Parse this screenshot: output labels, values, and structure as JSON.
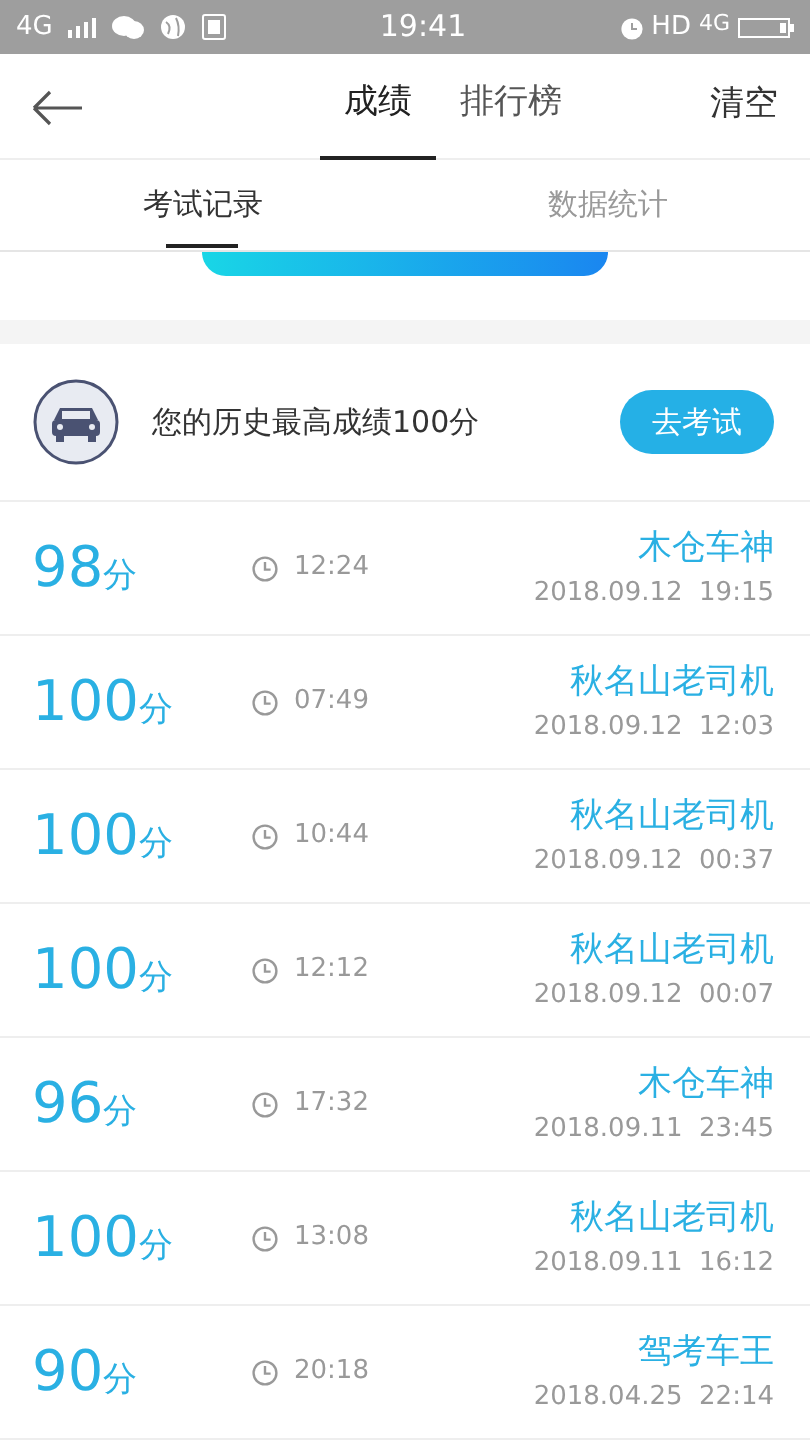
{
  "status_bar": {
    "network_left": "4G",
    "time": "19:41",
    "hd": "HD",
    "network_right": "4G"
  },
  "top_nav": {
    "tabs": [
      {
        "label": "成绩",
        "selected": true
      },
      {
        "label": "排行榜",
        "selected": false
      }
    ],
    "action": "清空"
  },
  "sub_tabs": [
    {
      "label": "考试记录",
      "selected": true
    },
    {
      "label": "数据统计",
      "selected": false
    }
  ],
  "best": {
    "text": "您的历史最高成绩100分",
    "button": "去考试"
  },
  "records": [
    {
      "score": "98",
      "unit": "分",
      "duration": "12:24",
      "title": "木仓车神",
      "date": "2018.09.12  19:15"
    },
    {
      "score": "100",
      "unit": "分",
      "duration": "07:49",
      "title": "秋名山老司机",
      "date": "2018.09.12  12:03"
    },
    {
      "score": "100",
      "unit": "分",
      "duration": "10:44",
      "title": "秋名山老司机",
      "date": "2018.09.12  00:37"
    },
    {
      "score": "100",
      "unit": "分",
      "duration": "12:12",
      "title": "秋名山老司机",
      "date": "2018.09.12  00:07"
    },
    {
      "score": "96",
      "unit": "分",
      "duration": "17:32",
      "title": "木仓车神",
      "date": "2018.09.11  23:45"
    },
    {
      "score": "100",
      "unit": "分",
      "duration": "13:08",
      "title": "秋名山老司机",
      "date": "2018.09.11  16:12"
    },
    {
      "score": "90",
      "unit": "分",
      "duration": "20:18",
      "title": "驾考车王",
      "date": "2018.04.25  22:14"
    }
  ]
}
